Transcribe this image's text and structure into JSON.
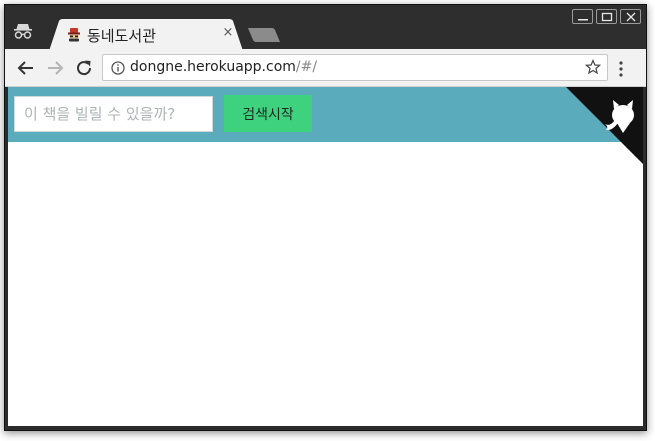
{
  "tab": {
    "title": "동네도서관",
    "close_glyph": "×",
    "favicon_icon": "spy-hat-icon"
  },
  "window_controls": [
    "minimize",
    "maximize",
    "close"
  ],
  "address_bar": {
    "host": "dongne.herokuapp.com",
    "path": "/#/",
    "info_icon": "info-icon",
    "bookmark_icon": "star-icon"
  },
  "toolbar": {
    "back_icon": "back-arrow-icon",
    "forward_icon": "forward-arrow-icon",
    "reload_icon": "reload-icon",
    "menu_icon": "kebab-menu-icon"
  },
  "page": {
    "search": {
      "placeholder": "이 책을 빌릴 수 있을까?",
      "value": "",
      "button_label": "검색시작"
    },
    "colors": {
      "header_bg": "#5aabbb",
      "button_bg": "#3fd27e",
      "corner_bg": "#111111"
    },
    "corner_icon": "github-octocat-icon"
  }
}
